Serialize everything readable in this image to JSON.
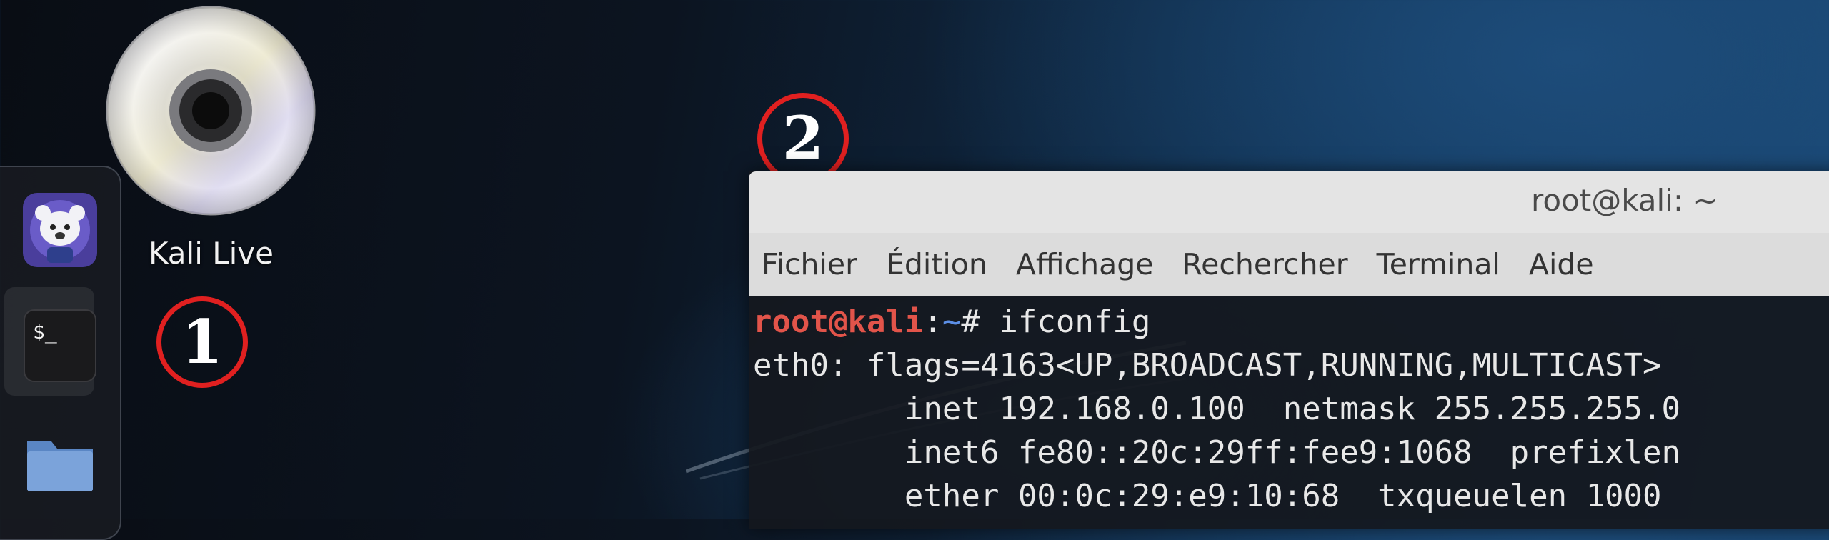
{
  "desktop": {
    "icon_label": "Kali Live",
    "icon_name": "optical-disc-icon"
  },
  "dock": {
    "items": [
      {
        "name": "app-mascot-icon"
      },
      {
        "name": "terminal-icon",
        "glyph": "$_"
      },
      {
        "name": "folder-icon"
      }
    ],
    "accent": "#4b8fe0"
  },
  "markers": {
    "m1": "1",
    "m2": "2",
    "color": "#e02020"
  },
  "terminal": {
    "title": "root@kali: ~",
    "menu": [
      "Fichier",
      "Édition",
      "Affichage",
      "Rechercher",
      "Terminal",
      "Aide"
    ],
    "prompt_user": "root@kali",
    "prompt_sep": ":",
    "prompt_path": "~",
    "prompt_symbol": "# ",
    "command": "ifconfig",
    "output": [
      "eth0: flags=4163<UP,BROADCAST,RUNNING,MULTICAST>",
      "        inet 192.168.0.100  netmask 255.255.255.0",
      "        inet6 fe80::20c:29ff:fee9:1068  prefixlen",
      "        ether 00:0c:29:e9:10:68  txqueuelen 1000"
    ]
  }
}
